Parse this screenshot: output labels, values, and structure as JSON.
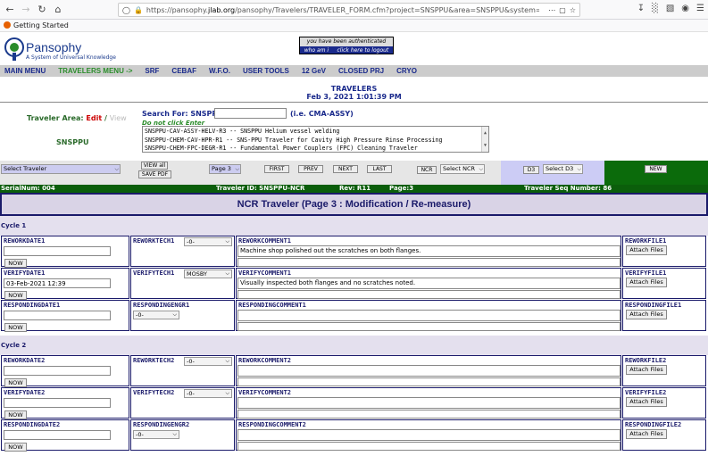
{
  "browser": {
    "url_prefix": "https://pansophy.",
    "url_host": "jlab.org",
    "url_rest": "/pansophy/Travelers/TRAVELER_FORM.cfm?project=SNSPPU&area=SNSPPU&system=INSP&TRAV_ID=",
    "bookmark": "Getting Started"
  },
  "header": {
    "brand": "Pansophy",
    "tagline": "A System of Universal Knowledge",
    "auth_text": "you have been authenticated",
    "who_label": "who am i",
    "logout_label": "click here to logout"
  },
  "menu": [
    {
      "label": "MAIN MENU",
      "active": false
    },
    {
      "label": "TRAVELERS MENU ->",
      "active": true
    },
    {
      "label": "SRF",
      "active": false
    },
    {
      "label": "CEBAF",
      "active": false
    },
    {
      "label": "W.F.O.",
      "active": false
    },
    {
      "label": "USER TOOLS",
      "active": false
    },
    {
      "label": "12 GeV",
      "active": false
    },
    {
      "label": "CLOSED PRJ",
      "active": false
    },
    {
      "label": "CRYO",
      "active": false
    }
  ],
  "title": {
    "heading": "TRAVELERS",
    "datetime": "Feb 3, 2021 1:01:39 PM"
  },
  "area": {
    "label": "Traveler Area:",
    "edit": "Edit",
    "slash": "/",
    "view": "View",
    "name": "SNSPPU"
  },
  "search": {
    "label": "Search For: SNSPPU-",
    "value": "",
    "hint": "(i.e. CMA-ASSY)",
    "warning": "Do not click Enter"
  },
  "traveler_list": [
    "SNSPPU-CAV-ASSY-HELV-R3 -- SNSPPU Helium vessel welding",
    "SNSPPU-CHEM-CAV-HPR-R1 -- SNS-PPU Traveler for Cavity High Pressure Rinse Processing",
    "SNSPPU-CHEM-FPC-DEGR-R1 -- Fundamental Power Couplers (FPC) Cleaning Traveler"
  ],
  "toolbar": {
    "select_traveler": "Select Traveler",
    "view_all": "VIEW all",
    "save_pdf": "SAVE PDF",
    "page_select": "Page 3",
    "first": "FIRST",
    "prev": "PREV",
    "next": "NEXT",
    "last": "LAST",
    "ncr_label": "NCR",
    "ncr_select": "Select NCR",
    "d3_label": "D3",
    "d3_select": "Select D3",
    "new": "NEW"
  },
  "status": {
    "serial": "SerialNum: 004",
    "traveler_id": "Traveler ID: SNSPPU-NCR",
    "rev": "Rev: R11",
    "page": "Page:3",
    "seq": "Traveler Seq Number: 86"
  },
  "ncr_title": "NCR Traveler (Page 3 : Modification / Re-measure)",
  "cycles": [
    {
      "label": "Cycle 1",
      "rows": [
        {
          "date_label": "REWORKDATE1",
          "date_value": "",
          "who_label": "REWORKTECH1",
          "who_value": "-0-",
          "comment_label": "REWORKCOMMENT1",
          "comment_value": "Machine shop polished out the scratches on both flanges.",
          "file_label": "REWORKFILE1"
        },
        {
          "date_label": "VERIFYDATE1",
          "date_value": "03-Feb-2021 12:39",
          "who_label": "VERIFYTECH1",
          "who_value": "MOSBY",
          "comment_label": "VERIFYCOMMENT1",
          "comment_value": "Visually inspected both flanges and no scratches noted.",
          "file_label": "VERIFYFILE1"
        },
        {
          "date_label": "RESPONDINGDATE1",
          "date_value": "",
          "who_label": "RESPONDINGENGR1",
          "who_value": "-0-",
          "comment_label": "RESPONDINGCOMMENT1",
          "comment_value": "",
          "file_label": "RESPONDINGFILE1"
        }
      ]
    },
    {
      "label": "Cycle 2",
      "rows": [
        {
          "date_label": "REWORKDATE2",
          "date_value": "",
          "who_label": "REWORKTECH2",
          "who_value": "-0-",
          "comment_label": "REWORKCOMMENT2",
          "comment_value": "",
          "file_label": "REWORKFILE2"
        },
        {
          "date_label": "VERIFYDATE2",
          "date_value": "",
          "who_label": "VERIFYTECH2",
          "who_value": "-0-",
          "comment_label": "VERIFYCOMMENT2",
          "comment_value": "",
          "file_label": "VERIFYFILE2"
        },
        {
          "date_label": "RESPONDINGDATE2",
          "date_value": "",
          "who_label": "RESPONDINGENGR2",
          "who_value": "-0-",
          "comment_label": "RESPONDINGCOMMENT2",
          "comment_value": "",
          "file_label": "RESPONDINGFILE2"
        }
      ]
    }
  ],
  "now_label": "NOW",
  "attach_label": "Attach Files",
  "colors": {
    "brand_blue": "#1a2a8c",
    "menu_green": "#2a8c2a",
    "status_green": "#0b5e0b",
    "title_bg": "#d9d3e6"
  }
}
